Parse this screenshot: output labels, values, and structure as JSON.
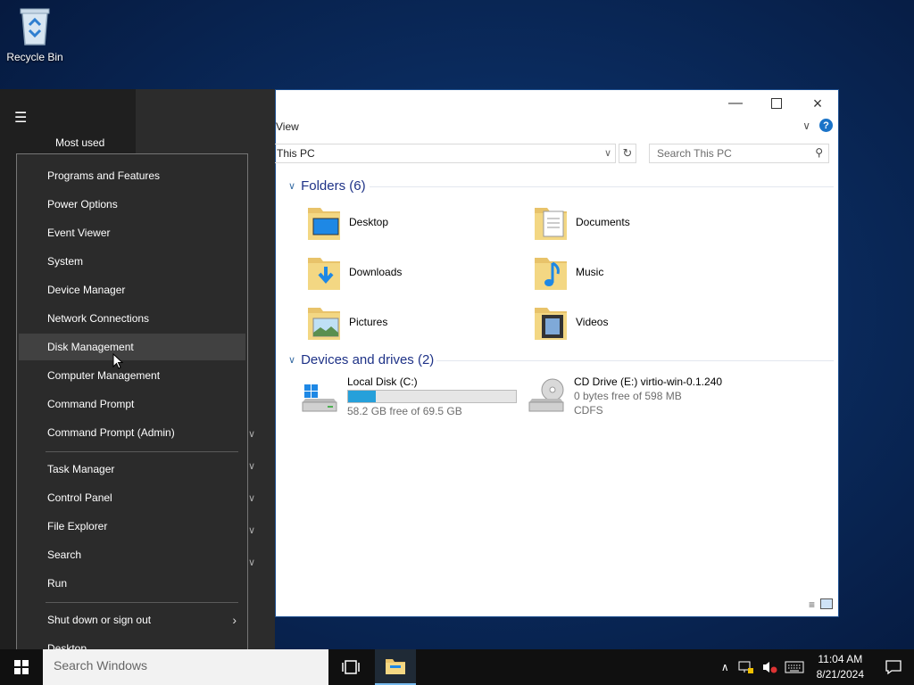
{
  "desktop": {
    "recycle_bin_label": "Recycle Bin"
  },
  "explorer": {
    "ribbon_tab_label": "View",
    "address_text": "This PC",
    "search_placeholder": "Search This PC",
    "folders_header": "Folders (6)",
    "folders": [
      {
        "label": "Desktop",
        "icon": "desktop-folder-icon"
      },
      {
        "label": "Documents",
        "icon": "documents-folder-icon"
      },
      {
        "label": "Downloads",
        "icon": "downloads-folder-icon"
      },
      {
        "label": "Music",
        "icon": "music-folder-icon"
      },
      {
        "label": "Pictures",
        "icon": "pictures-folder-icon"
      },
      {
        "label": "Videos",
        "icon": "videos-folder-icon"
      }
    ],
    "drives_header": "Devices and drives (2)",
    "drives": [
      {
        "name": "Local Disk (C:)",
        "free_text": "58.2 GB free of 69.5 GB",
        "used_fraction": 0.163,
        "icon": "local-disk-icon"
      },
      {
        "name": "CD Drive (E:) virtio-win-0.1.240",
        "free_text": "0 bytes free of 598 MB",
        "fs_text": "CDFS",
        "icon": "cd-drive-icon"
      }
    ]
  },
  "start_menu": {
    "most_used_label": "Most used"
  },
  "context_menu": {
    "items": [
      {
        "label": "Programs and Features"
      },
      {
        "label": "Power Options"
      },
      {
        "label": "Event Viewer"
      },
      {
        "label": "System"
      },
      {
        "label": "Device Manager"
      },
      {
        "label": "Network Connections"
      },
      {
        "label": "Disk Management",
        "highlighted": true
      },
      {
        "label": "Computer Management"
      },
      {
        "label": "Command Prompt"
      },
      {
        "label": "Command Prompt (Admin)"
      },
      {
        "label": "Task Manager"
      },
      {
        "label": "Control Panel"
      },
      {
        "label": "File Explorer"
      },
      {
        "label": "Search"
      },
      {
        "label": "Run"
      },
      {
        "label": "Shut down or sign out",
        "has_submenu": true
      },
      {
        "label": "Desktop"
      }
    ]
  },
  "taskbar": {
    "search_placeholder": "Search Windows",
    "time": "11:04 AM",
    "date": "8/21/2024"
  },
  "colors": {
    "accent": "#26a0da",
    "header_blue": "#1e3287",
    "menu_bg": "#2b2b2b",
    "menu_highlight": "#414141"
  }
}
